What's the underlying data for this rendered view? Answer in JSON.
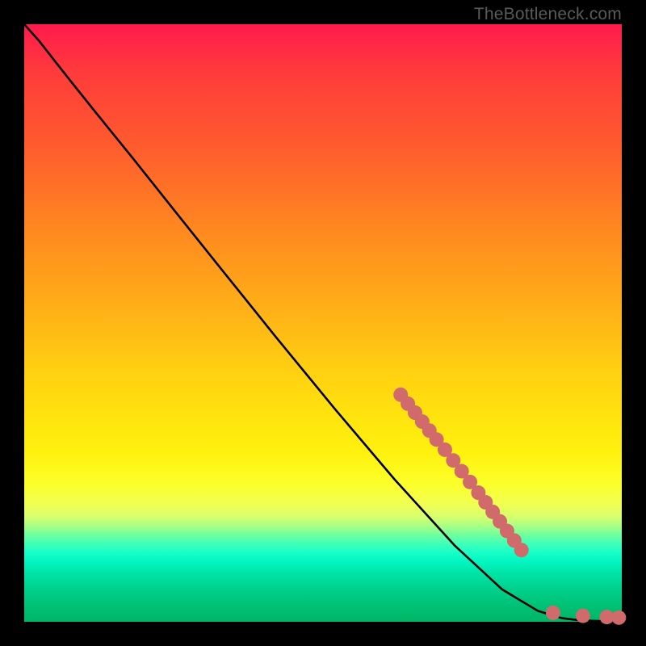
{
  "watermark": "TheBottleneck.com",
  "colors": {
    "dot": "#d16a6a",
    "curve": "#000000"
  },
  "dot_radius": 9,
  "chart_data": {
    "type": "line",
    "title": "",
    "xlabel": "",
    "ylabel": "",
    "xlim": [
      0,
      100
    ],
    "ylim": [
      0,
      100
    ],
    "grid": false,
    "legend": false,
    "note": "x and y are normalized to 0–100; no axis ticks or labels are visible in the image.",
    "series": [
      {
        "name": "curve",
        "type": "line",
        "x": [
          0,
          2.5,
          5,
          8,
          12,
          18,
          25,
          33,
          42,
          52,
          62,
          72,
          80,
          86,
          90,
          93,
          95.5,
          97.5,
          99,
          100
        ],
        "y": [
          100,
          97.2,
          94.0,
          90.2,
          85.2,
          77.8,
          69.0,
          59.0,
          47.8,
          35.6,
          23.8,
          12.8,
          5.4,
          1.8,
          0.6,
          0.25,
          0.15,
          0.1,
          0.08,
          0.07
        ]
      },
      {
        "name": "dots",
        "type": "scatter",
        "x": [
          63.0,
          64.2,
          65.4,
          66.6,
          67.8,
          69.0,
          70.4,
          71.8,
          73.2,
          74.6,
          76.0,
          77.2,
          78.4,
          79.6,
          80.8,
          82.0,
          83.2,
          88.5,
          93.5,
          97.5,
          99.5
        ],
        "y": [
          38.0,
          36.5,
          35.0,
          33.5,
          32.0,
          30.5,
          28.8,
          27.0,
          25.2,
          23.4,
          21.6,
          20.0,
          18.4,
          16.8,
          15.2,
          13.6,
          12.0,
          1.5,
          1.0,
          0.8,
          0.7
        ]
      }
    ]
  }
}
